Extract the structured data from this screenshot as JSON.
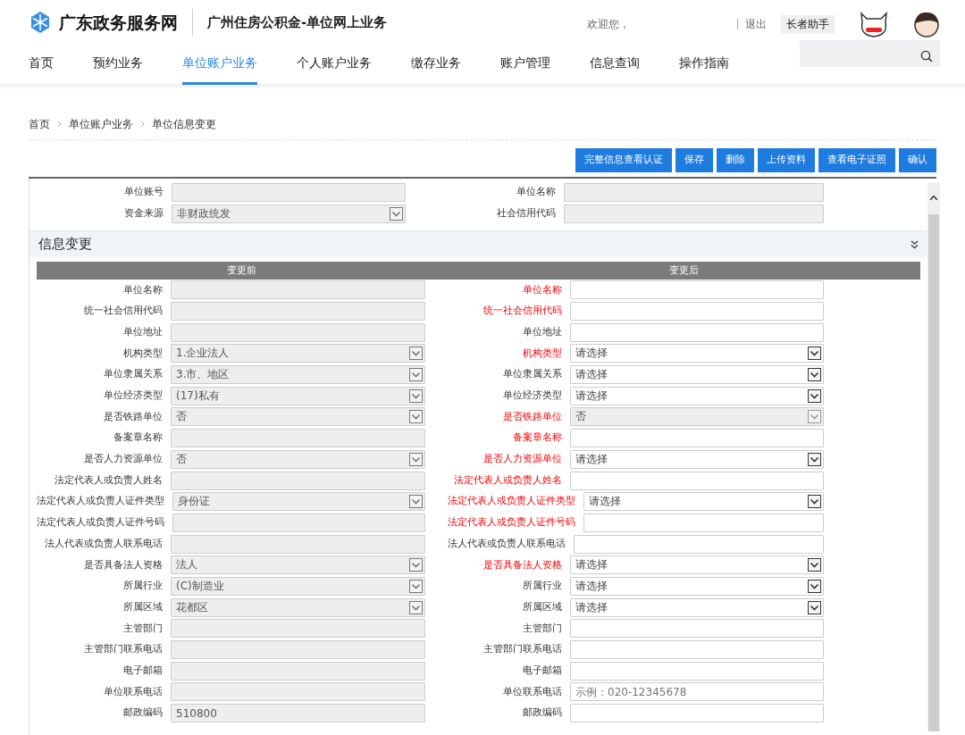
{
  "header": {
    "site_name": "广东政务服务网",
    "app_title": "广州住房公积金-单位网上业务",
    "welcome": "欢迎您，",
    "logout": "退出",
    "elder_mode": "长者助手"
  },
  "nav": [
    {
      "label": "首页",
      "selected": false
    },
    {
      "label": "预约业务",
      "selected": false
    },
    {
      "label": "单位账户业务",
      "selected": true
    },
    {
      "label": "个人账户业务",
      "selected": false
    },
    {
      "label": "缴存业务",
      "selected": false
    },
    {
      "label": "账户管理",
      "selected": false
    },
    {
      "label": "信息查询",
      "selected": false
    },
    {
      "label": "操作指南",
      "selected": false
    }
  ],
  "breadcrumb": [
    "首页",
    "单位账户业务",
    "单位信息变更"
  ],
  "buttons": [
    "完整信息查看认证",
    "保存",
    "删除",
    "上传资料",
    "查看电子证照",
    "确认"
  ],
  "summary": [
    {
      "label": "单位账号",
      "kind": "input"
    },
    {
      "label": "单位名称",
      "kind": "input"
    },
    {
      "label": "资金来源",
      "kind": "select",
      "value": "非财政统发"
    },
    {
      "label": "社会信用代码",
      "kind": "input"
    }
  ],
  "section": {
    "title": "信息变更",
    "columns": [
      "变更前",
      "变更后"
    ]
  },
  "rows": [
    {
      "before": {
        "label": "单位名称",
        "kind": "input"
      },
      "after": {
        "label": "单位名称",
        "kind": "input",
        "required": true,
        "disabled": false
      }
    },
    {
      "before": {
        "label": "统一社会信用代码",
        "kind": "input"
      },
      "after": {
        "label": "统一社会信用代码",
        "kind": "input",
        "required": true,
        "disabled": false
      }
    },
    {
      "before": {
        "label": "单位地址",
        "kind": "input"
      },
      "after": {
        "label": "单位地址",
        "kind": "input",
        "required": false,
        "disabled": false
      }
    },
    {
      "before": {
        "label": "机构类型",
        "kind": "select",
        "value": "1.企业法人"
      },
      "after": {
        "label": "机构类型",
        "kind": "select",
        "value": "请选择",
        "required": true,
        "disabled": false
      }
    },
    {
      "before": {
        "label": "单位隶属关系",
        "kind": "select",
        "value": "3.市、地区"
      },
      "after": {
        "label": "单位隶属关系",
        "kind": "select",
        "value": "请选择",
        "required": false,
        "disabled": false
      }
    },
    {
      "before": {
        "label": "单位经济类型",
        "kind": "select",
        "value": "(17)私有"
      },
      "after": {
        "label": "单位经济类型",
        "kind": "select",
        "value": "请选择",
        "required": false,
        "disabled": false
      }
    },
    {
      "before": {
        "label": "是否铁路单位",
        "kind": "select",
        "value": "否"
      },
      "after": {
        "label": "是否铁路单位",
        "kind": "select",
        "value": "否",
        "required": true,
        "disabled": true
      }
    },
    {
      "before": {
        "label": "备案章名称",
        "kind": "input"
      },
      "after": {
        "label": "备案章名称",
        "kind": "input",
        "required": true,
        "disabled": false
      }
    },
    {
      "before": {
        "label": "是否人力资源单位",
        "kind": "select",
        "value": "否"
      },
      "after": {
        "label": "是否人力资源单位",
        "kind": "select",
        "value": "请选择",
        "required": true,
        "disabled": false
      }
    },
    {
      "before": {
        "label": "法定代表人或负责人姓名",
        "kind": "input"
      },
      "after": {
        "label": "法定代表人或负责人姓名",
        "kind": "input",
        "required": true,
        "disabled": false
      }
    },
    {
      "before": {
        "label": "法定代表人或负责人证件类型",
        "kind": "select",
        "value": "身份证"
      },
      "after": {
        "label": "法定代表人或负责人证件类型",
        "kind": "select",
        "value": "请选择",
        "required": true,
        "disabled": false
      }
    },
    {
      "before": {
        "label": "法定代表人或负责人证件号码",
        "kind": "input"
      },
      "after": {
        "label": "法定代表人或负责人证件号码",
        "kind": "input",
        "required": true,
        "disabled": false
      }
    },
    {
      "before": {
        "label": "法人代表或负责人联系电话",
        "kind": "input"
      },
      "after": {
        "label": "法人代表或负责人联系电话",
        "kind": "input",
        "required": false,
        "disabled": false
      }
    },
    {
      "before": {
        "label": "是否具备法人资格",
        "kind": "select",
        "value": "法人"
      },
      "after": {
        "label": "是否具备法人资格",
        "kind": "select",
        "value": "请选择",
        "required": true,
        "disabled": false
      }
    },
    {
      "before": {
        "label": "所属行业",
        "kind": "select",
        "value": "(C)制造业"
      },
      "after": {
        "label": "所属行业",
        "kind": "select",
        "value": "请选择",
        "required": false,
        "disabled": false
      }
    },
    {
      "before": {
        "label": "所属区域",
        "kind": "select",
        "value": "花都区"
      },
      "after": {
        "label": "所属区域",
        "kind": "select",
        "value": "请选择",
        "required": false,
        "disabled": false
      }
    },
    {
      "before": {
        "label": "主管部门",
        "kind": "input"
      },
      "after": {
        "label": "主管部门",
        "kind": "input",
        "required": false,
        "disabled": false
      }
    },
    {
      "before": {
        "label": "主管部门联系电话",
        "kind": "input"
      },
      "after": {
        "label": "主管部门联系电话",
        "kind": "input",
        "required": false,
        "disabled": false
      }
    },
    {
      "before": {
        "label": "电子邮箱",
        "kind": "input"
      },
      "after": {
        "label": "电子邮箱",
        "kind": "input",
        "required": false,
        "disabled": false
      }
    },
    {
      "before": {
        "label": "单位联系电话",
        "kind": "input"
      },
      "after": {
        "label": "单位联系电话",
        "kind": "input",
        "placeholder": "示例：020-12345678",
        "required": false,
        "disabled": false
      }
    },
    {
      "before": {
        "label": "邮政编码",
        "kind": "input",
        "value": "510800"
      },
      "after": {
        "label": "邮政编码",
        "kind": "input",
        "required": false,
        "disabled": false
      }
    }
  ]
}
